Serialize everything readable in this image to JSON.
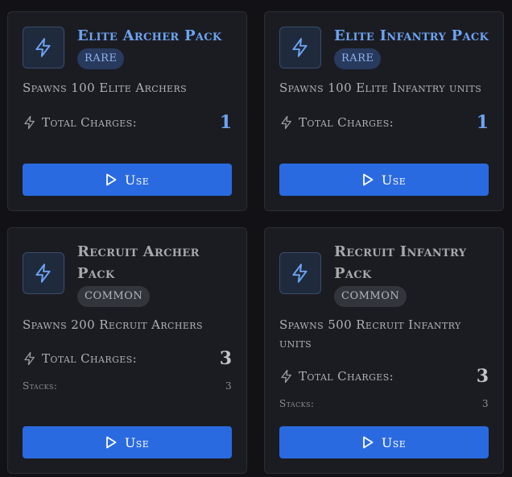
{
  "colors": {
    "background": "#121216",
    "card": "#1b1c22",
    "rare_accent": "#6da4f2",
    "button": "#2a6ae0"
  },
  "labels": {
    "total_charges": "Total Charges:",
    "stacks": "Stacks:",
    "use": "Use"
  },
  "cards": [
    {
      "title": "Elite Archer Pack",
      "rarity": "RARE",
      "description": "Spawns 100 Elite Archers",
      "total_charges": "1",
      "icon": "lightning-bolt-icon"
    },
    {
      "title": "Elite Infantry Pack",
      "rarity": "RARE",
      "description": "Spawns 100 Elite Infantry units",
      "total_charges": "1",
      "icon": "lightning-bolt-icon"
    },
    {
      "title": "Recruit Archer Pack",
      "rarity": "COMMON",
      "description": "Spawns 200 Recruit Archers",
      "total_charges": "3",
      "stacks": "3",
      "icon": "lightning-bolt-icon"
    },
    {
      "title": "Recruit Infantry Pack",
      "rarity": "COMMON",
      "description": "Spawns 500 Recruit Infantry units",
      "total_charges": "3",
      "stacks": "3",
      "icon": "lightning-bolt-icon"
    }
  ]
}
